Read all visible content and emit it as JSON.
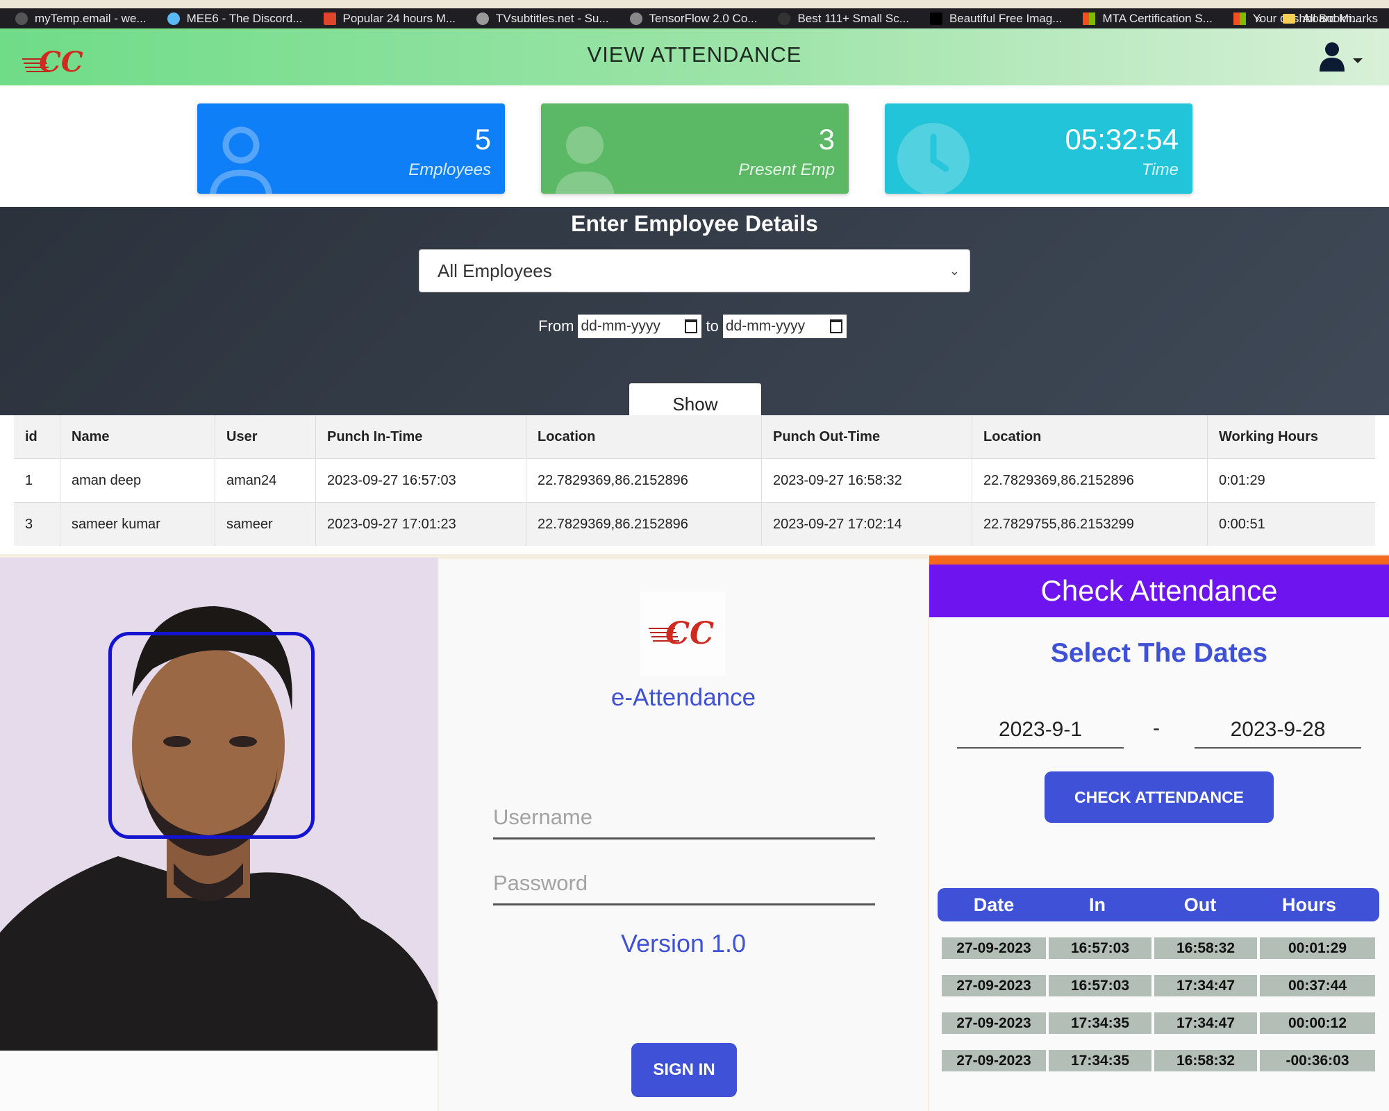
{
  "bookmarks": {
    "items": [
      {
        "label": "myTemp.email - we...",
        "color": "#555555"
      },
      {
        "label": "MEE6 - The Discord...",
        "color": "#5ab8f5"
      },
      {
        "label": "Popular 24 hours M...",
        "color": "#e0452c"
      },
      {
        "label": "TVsubtitles.net - Su...",
        "color": "#9a9a9a"
      },
      {
        "label": "TensorFlow 2.0 Co...",
        "color": "#888888"
      },
      {
        "label": "Best 111+ Small Sc...",
        "color": "#333333"
      },
      {
        "label": "Beautiful Free Imag...",
        "color": "#000000"
      },
      {
        "label": "MTA Certification S...",
        "color": "#f25022"
      },
      {
        "label": "Your dashboard Mi...",
        "color": "#f25022"
      }
    ],
    "overflow": "»",
    "all_bookmarks": "All Bookmarks"
  },
  "web": {
    "title": "VIEW ATTENDANCE",
    "logo_text": "CC",
    "cards": [
      {
        "value": "5",
        "label": "Employees",
        "color": "#0f7ff7",
        "icon": "user-icon"
      },
      {
        "value": "3",
        "label": "Present Emp",
        "color": "#5bb864",
        "icon": "user-icon"
      },
      {
        "value": "05:32:54",
        "label": "Time",
        "color": "#22c4d9",
        "icon": "clock-icon"
      }
    ],
    "form": {
      "title": "Enter Employee Details",
      "employee_select": "All Employees",
      "from_label": "From",
      "to_label": "to",
      "date_placeholder": "dd-mm-yyyy",
      "show_button": "Show"
    },
    "table": {
      "headers": [
        "id",
        "Name",
        "User",
        "Punch In-Time",
        "Location",
        "Punch Out-Time",
        "Location",
        "Working Hours"
      ],
      "rows": [
        [
          "1",
          "aman deep",
          "aman24",
          "2023-09-27 16:57:03",
          "22.7829369,86.2152896",
          "2023-09-27 16:58:32",
          "22.7829369,86.2152896",
          "0:01:29"
        ],
        [
          "3",
          "sameer kumar",
          "sameer",
          "2023-09-27 17:01:23",
          "22.7829369,86.2152896",
          "2023-09-27 17:02:14",
          "22.7829755,86.2153299",
          "0:00:51"
        ]
      ]
    }
  },
  "login": {
    "logo_text": "CC",
    "app_name": "e-Attendance",
    "username_placeholder": "Username",
    "password_placeholder": "Password",
    "version": "Version 1.0",
    "sign_in": "SIGN IN"
  },
  "mobile": {
    "title": "Check Attendance",
    "subtitle": "Select The Dates",
    "from_date": "2023-9-1",
    "separator": "-",
    "to_date": "2023-9-28",
    "check_button": "CHECK ATTENDANCE",
    "table": {
      "headers": [
        "Date",
        "In",
        "Out",
        "Hours"
      ],
      "rows": [
        [
          "27-09-2023",
          "16:57:03",
          "16:58:32",
          "00:01:29"
        ],
        [
          "27-09-2023",
          "16:57:03",
          "17:34:47",
          "00:37:44"
        ],
        [
          "27-09-2023",
          "17:34:35",
          "17:34:47",
          "00:00:12"
        ],
        [
          "27-09-2023",
          "17:34:35",
          "16:58:32",
          "-00:36:03"
        ]
      ]
    },
    "colors": {
      "status_bar": "#f36a1e",
      "app_bar": "#6e14ef",
      "accent": "#3f51d6"
    }
  }
}
